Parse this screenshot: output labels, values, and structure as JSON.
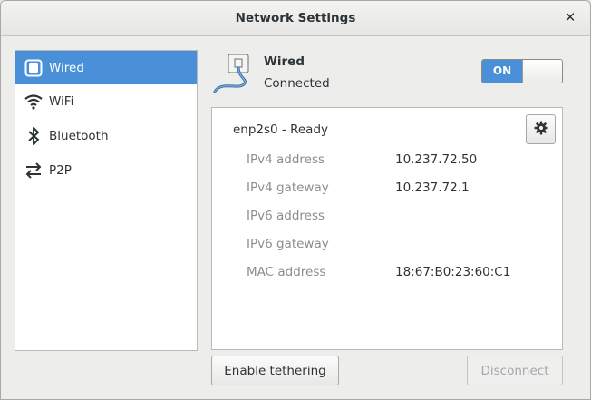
{
  "window": {
    "title": "Network Settings",
    "close_glyph": "✕"
  },
  "sidebar": {
    "items": [
      {
        "label": "Wired",
        "icon": "wired-icon",
        "active": true
      },
      {
        "label": "WiFi",
        "icon": "wifi-icon",
        "active": false
      },
      {
        "label": "Bluetooth",
        "icon": "bluetooth-icon",
        "active": false
      },
      {
        "label": "P2P",
        "icon": "p2p-icon",
        "active": false
      }
    ]
  },
  "header": {
    "name": "Wired",
    "status": "Connected",
    "switch_label": "ON",
    "icon": "ethernet-cable-icon"
  },
  "device": {
    "title": "enp2s0 - Ready",
    "settings_icon": "gear-icon",
    "rows": [
      {
        "key": "IPv4 address",
        "value": "10.237.72.50"
      },
      {
        "key": "IPv4 gateway",
        "value": "10.237.72.1"
      },
      {
        "key": "IPv6 address",
        "value": ""
      },
      {
        "key": "IPv6 gateway",
        "value": ""
      },
      {
        "key": "MAC address",
        "value": "18:67:B0:23:60:C1"
      }
    ]
  },
  "buttons": {
    "tether_label": "Enable tethering",
    "disconnect_label": "Disconnect"
  },
  "colors": {
    "accent": "#4a90d9",
    "dim_text": "#8a8e8f",
    "text": "#2e3436"
  }
}
